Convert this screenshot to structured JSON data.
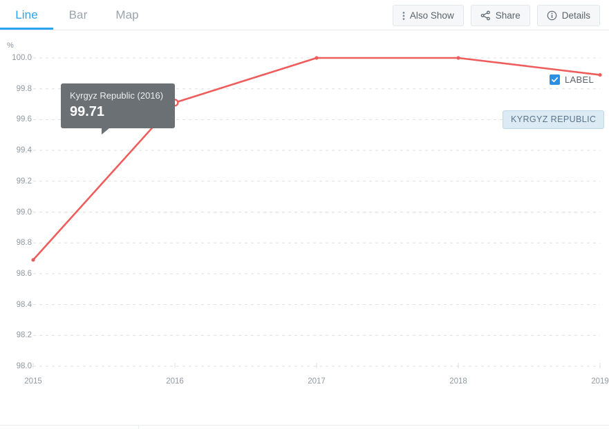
{
  "tabs": [
    {
      "label": "Line",
      "active": true
    },
    {
      "label": "Bar",
      "active": false
    },
    {
      "label": "Map",
      "active": false
    }
  ],
  "toolbar": {
    "also_show_label": "Also Show",
    "share_label": "Share",
    "details_label": "Details"
  },
  "legend": {
    "label_toggle_text": "LABEL",
    "label_toggle_checked": true,
    "series_badge": "KYRGYZ REPUBLIC"
  },
  "tooltip": {
    "title": "Kyrgyz Republic (2016)",
    "value": "99.71"
  },
  "colors": {
    "accent_blue": "#2aa3f0",
    "series_red": "#ef5c5c",
    "badge_bg": "#dceaf4",
    "tooltip_bg": "#6a7074",
    "grid": "#dcdfe2"
  },
  "chart_data": {
    "type": "line",
    "title": "",
    "xlabel": "",
    "ylabel": "%",
    "unit": "%",
    "x": [
      2015,
      2016,
      2017,
      2018,
      2019
    ],
    "xtick_labels": [
      "2015",
      "2016",
      "2017",
      "2018",
      "2019"
    ],
    "ytick_labels": [
      "100.0",
      "99.8",
      "99.6",
      "99.4",
      "99.2",
      "99.0",
      "98.8",
      "98.6",
      "98.4",
      "98.2",
      "98.0"
    ],
    "ytick_values": [
      100.0,
      99.8,
      99.6,
      99.4,
      99.2,
      99.0,
      98.8,
      98.6,
      98.4,
      98.2,
      98.0
    ],
    "ylim": [
      98.0,
      100.0
    ],
    "xlim": [
      2015,
      2019
    ],
    "grid": true,
    "legend_position": "inline-right",
    "series": [
      {
        "name": "Kyrgyz Republic",
        "color": "#ef5c5c",
        "values": [
          98.69,
          99.71,
          100.0,
          100.0,
          99.89
        ]
      }
    ],
    "highlighted_point": {
      "x": 2016,
      "y": 99.71
    }
  }
}
